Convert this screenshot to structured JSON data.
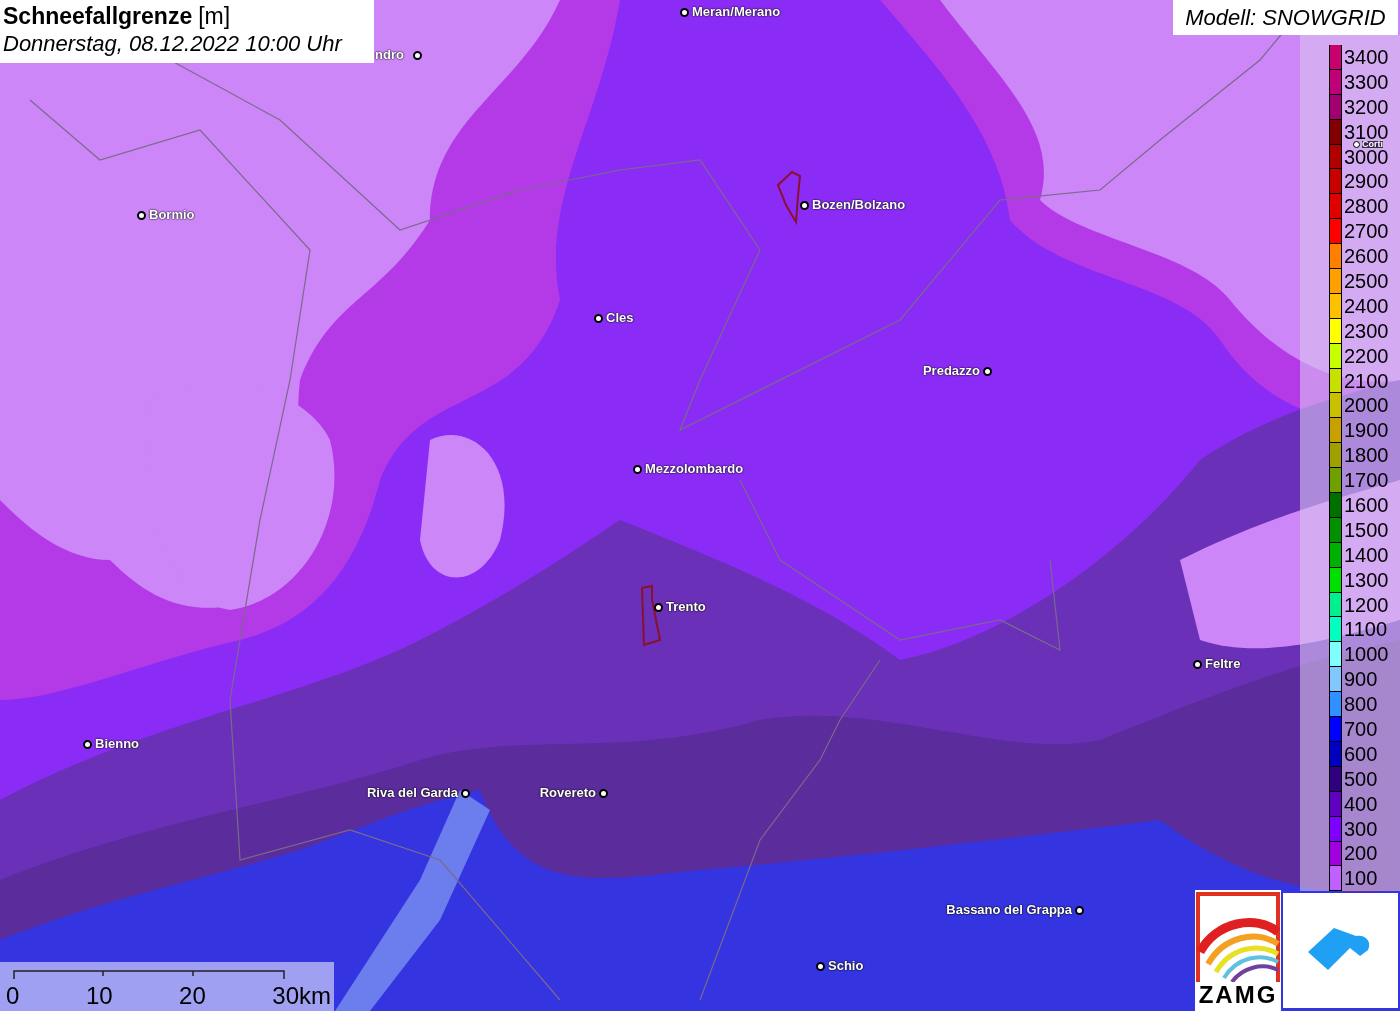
{
  "title": {
    "label": "Schneefallgrenze",
    "unit": "[m]",
    "datetime": "Donnerstag, 08.12.2022 10:00 Uhr"
  },
  "model": "Modell: SNOWGRID",
  "towns": [
    {
      "name": "ndro"
    },
    {
      "name": "Meran/Merano"
    },
    {
      "name": "Bormio"
    },
    {
      "name": "Bozen/Bolzano"
    },
    {
      "name": "Cles"
    },
    {
      "name": "Predazzo"
    },
    {
      "name": "Mezzolombardo"
    },
    {
      "name": "Trento"
    },
    {
      "name": "Feltre"
    },
    {
      "name": "Bienno"
    },
    {
      "name": "Riva del Garda"
    },
    {
      "name": "Rovereto"
    },
    {
      "name": "Bassano del Grappa"
    },
    {
      "name": "Schio"
    },
    {
      "name": "Corti"
    }
  ],
  "legend": [
    {
      "label": "3400",
      "color": "#c8006e"
    },
    {
      "label": "3300",
      "color": "#c00078"
    },
    {
      "label": "3200",
      "color": "#a00070"
    },
    {
      "label": "3100",
      "color": "#800000"
    },
    {
      "label": "3000",
      "color": "#b00000"
    },
    {
      "label": "2900",
      "color": "#c80000"
    },
    {
      "label": "2800",
      "color": "#e00000"
    },
    {
      "label": "2700",
      "color": "#ff0000"
    },
    {
      "label": "2600",
      "color": "#ff8000"
    },
    {
      "label": "2500",
      "color": "#ffa000"
    },
    {
      "label": "2400",
      "color": "#ffc000"
    },
    {
      "label": "2300",
      "color": "#ffff00"
    },
    {
      "label": "2200",
      "color": "#c8ff00"
    },
    {
      "label": "2100",
      "color": "#c8e000"
    },
    {
      "label": "2000",
      "color": "#c8c000"
    },
    {
      "label": "1900",
      "color": "#c8a000"
    },
    {
      "label": "1800",
      "color": "#a0a000"
    },
    {
      "label": "1700",
      "color": "#70a000"
    },
    {
      "label": "1600",
      "color": "#007000"
    },
    {
      "label": "1500",
      "color": "#009000"
    },
    {
      "label": "1400",
      "color": "#00b000"
    },
    {
      "label": "1300",
      "color": "#00e000"
    },
    {
      "label": "1200",
      "color": "#00f090"
    },
    {
      "label": "1100",
      "color": "#00ffc0"
    },
    {
      "label": "1000",
      "color": "#80ffff"
    },
    {
      "label": "900",
      "color": "#80c8ff"
    },
    {
      "label": "800",
      "color": "#3090ff"
    },
    {
      "label": "700",
      "color": "#0000ff"
    },
    {
      "label": "600",
      "color": "#0000c0"
    },
    {
      "label": "500",
      "color": "#300080"
    },
    {
      "label": "400",
      "color": "#6000c0"
    },
    {
      "label": "300",
      "color": "#8000ff"
    },
    {
      "label": "200",
      "color": "#a000e0"
    },
    {
      "label": "100",
      "color": "#c060ff"
    }
  ],
  "scale_bar": {
    "labels": [
      "0",
      "10",
      "20",
      "30km"
    ]
  },
  "logo": {
    "text": "ZAMG"
  }
}
